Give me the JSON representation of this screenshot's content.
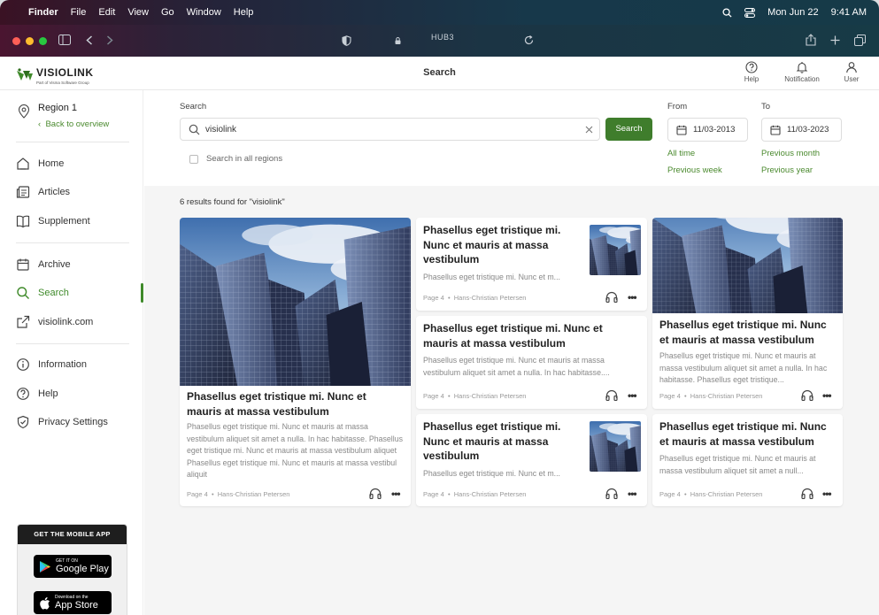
{
  "menubar": {
    "app": "Finder",
    "menus": [
      "File",
      "Edit",
      "View",
      "Go",
      "Window",
      "Help"
    ],
    "date": "Mon Jun 22",
    "time": "9:41 AM"
  },
  "browser": {
    "url": "HUB3"
  },
  "header": {
    "title": "Search",
    "help": "Help",
    "notification": "Notification",
    "user": "User"
  },
  "sidebar": {
    "region": "Region 1",
    "back": "Back to overview",
    "items": [
      {
        "label": "Home",
        "icon": "home-icon"
      },
      {
        "label": "Articles",
        "icon": "articles-icon"
      },
      {
        "label": "Supplement",
        "icon": "book-icon"
      },
      {
        "label": "Archive",
        "icon": "calendar-icon"
      },
      {
        "label": "Search",
        "icon": "search-icon"
      },
      {
        "label": "visiolink.com",
        "icon": "external-link-icon"
      },
      {
        "label": "Information",
        "icon": "info-icon"
      },
      {
        "label": "Help",
        "icon": "help-icon"
      },
      {
        "label": "Privacy Settings",
        "icon": "shield-icon"
      }
    ],
    "mobile_app": {
      "heading": "GET THE MOBILE APP",
      "google_small": "GET IT ON",
      "google_big": "Google Play",
      "apple_small": "Download on the",
      "apple_big": "App Store"
    }
  },
  "search": {
    "label": "Search",
    "value": "visiolink",
    "button": "Search",
    "all_regions": "Search in all regions",
    "from_label": "From",
    "from_value": "11/03-2013",
    "to_label": "To",
    "to_value": "11/03-2023",
    "quick_from": [
      "All time",
      "Previous week"
    ],
    "quick_to": [
      "Previous month",
      "Previous year"
    ]
  },
  "results": {
    "count_text": "6 results found for \"visiolink\"",
    "cards": [
      {
        "title": "Phasellus eget tristique mi. Nunc et mauris at massa vestibulum",
        "excerpt": "Phasellus eget tristique mi. Nunc et mauris at massa vestibulum aliquet sit amet a nulla. In hac habitasse. Phasellus eget tristique mi. Nunc et mauris at massa vestibulum aliquet Phasellus eget tristique mi. Nunc et mauris at massa vestibul aliquit",
        "page": "Page 4",
        "author": "Hans-Christian Petersen"
      },
      {
        "title": "Phasellus eget tristique mi. Nunc et mauris at massa vestibulum",
        "excerpt": "Phasellus eget tristique mi. Nunc et m...",
        "page": "Page 4",
        "author": "Hans-Christian Petersen"
      },
      {
        "title": "Phasellus eget tristique mi. Nunc et mauris at massa vestibulum",
        "excerpt": "Phasellus eget tristique mi. Nunc et mauris at massa vestibulum aliquet sit amet a nulla. In hac habitasse....",
        "page": "Page 4",
        "author": "Hans-Christian Petersen"
      },
      {
        "title": "Phasellus eget tristique mi. Nunc et mauris at massa vestibulum",
        "excerpt": "Phasellus eget tristique mi. Nunc et m...",
        "page": "Page 4",
        "author": "Hans-Christian Petersen"
      },
      {
        "title": "Phasellus eget tristique mi. Nunc et mauris at massa vestibulum",
        "excerpt": "Phasellus eget tristique mi. Nunc et mauris at massa vestibulum aliquet sit amet a nulla. In hac habitasse. Phasellus eget tristique...",
        "page": "Page 4",
        "author": "Hans-Christian Petersen"
      },
      {
        "title": "Phasellus eget tristique mi. Nunc et mauris at massa vestibulum",
        "excerpt": "Phasellus eget tristique mi. Nunc et mauris at massa vestibulum aliquet sit amet a null...",
        "page": "Page 4",
        "author": "Hans-Christian Petersen"
      }
    ]
  },
  "colors": {
    "accent": "#3f7d2c",
    "link": "#4b8a2f"
  }
}
